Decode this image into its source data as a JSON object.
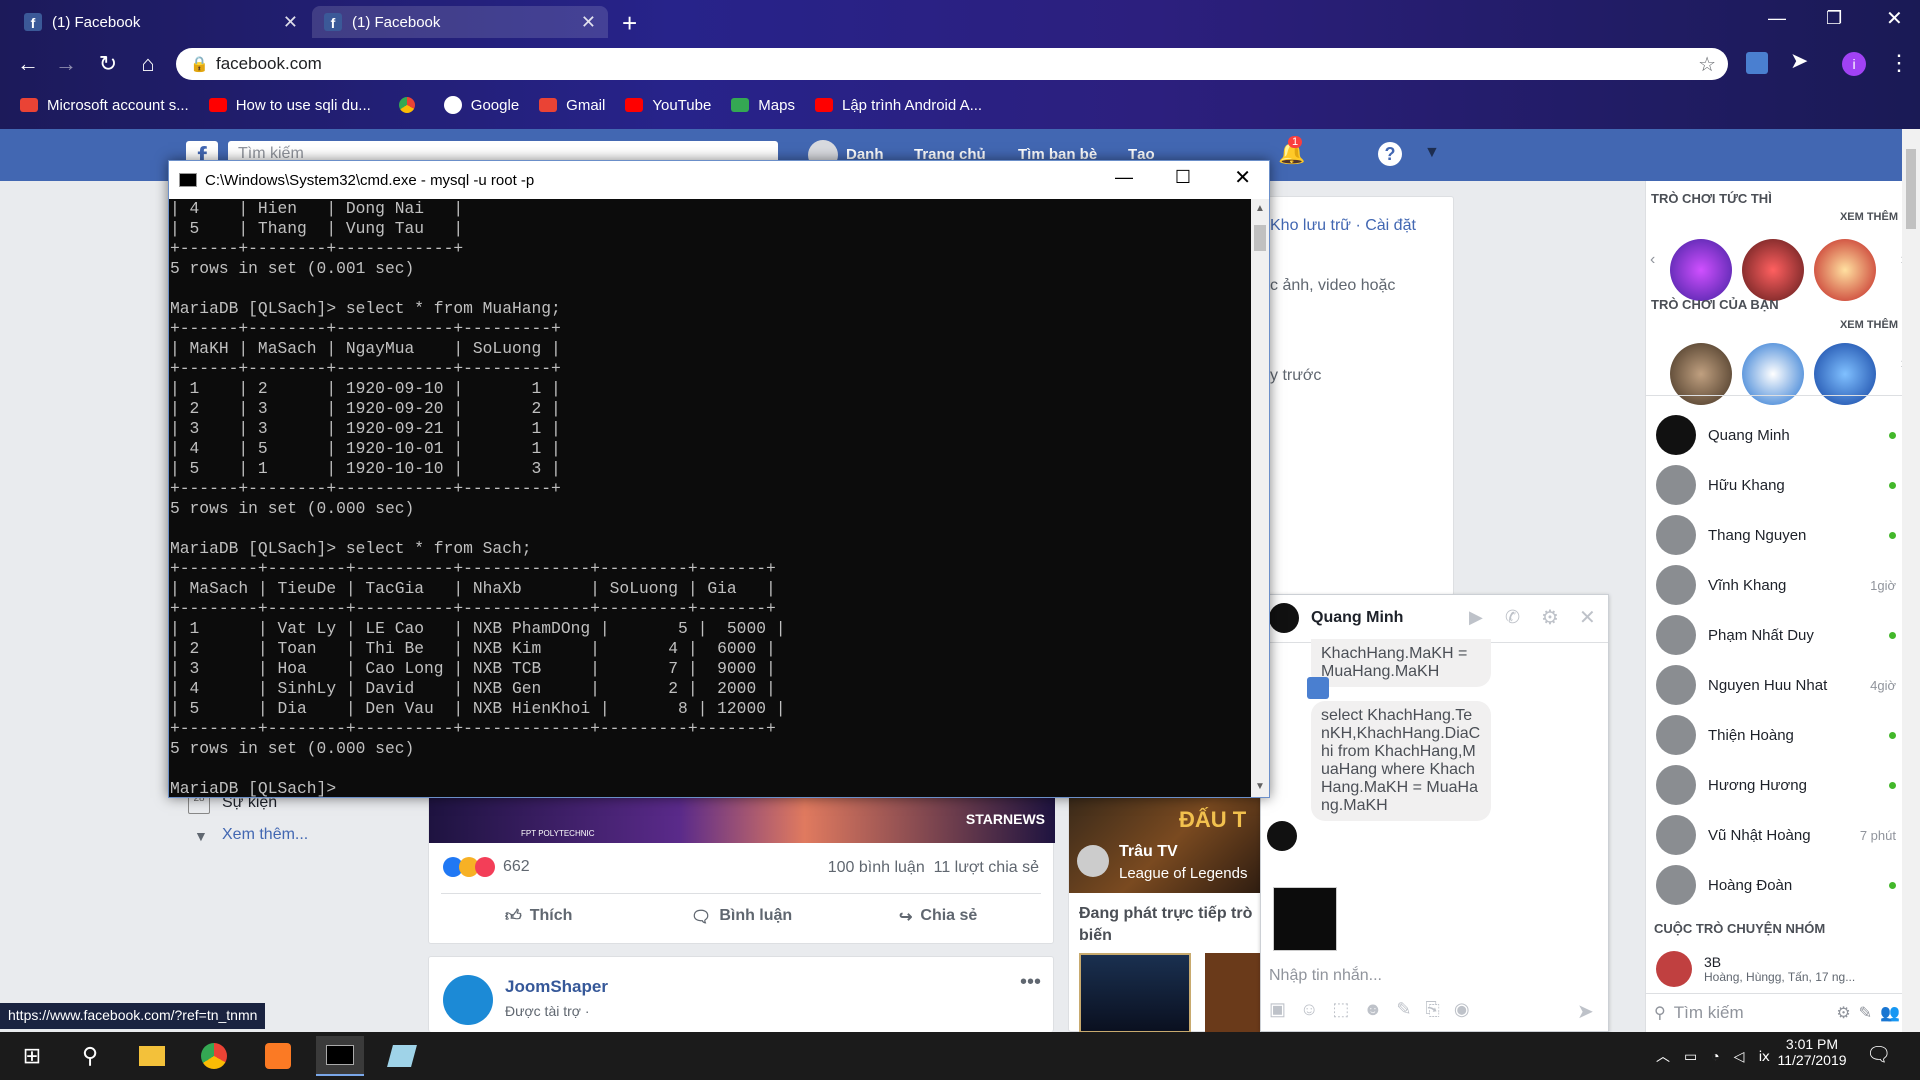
{
  "browser": {
    "tabs": [
      {
        "title": "(1) Facebook"
      },
      {
        "title": "(1) Facebook"
      }
    ],
    "url": "facebook.com",
    "bookmarks": [
      "Microsoft account s...",
      "How to use sqli du...",
      "Google",
      "Gmail",
      "YouTube",
      "Maps",
      "Lập trình Android A..."
    ],
    "profile_initial": "i",
    "status_url": "https://www.facebook.com/?ref=tn_tnmn"
  },
  "facebook": {
    "search_placeholder": "Tìm kiếm",
    "nav": [
      "Danh",
      "Trang chủ",
      "Tìm bạn bè",
      "Tạo"
    ],
    "notification_count": "1",
    "left_menu": [
      "Sự kiện",
      "Xem thêm..."
    ],
    "right_bits": [
      "Kho lưu trữ · Cài đặt",
      "c ảnh, video hoặc",
      "y trước"
    ],
    "post": {
      "reactions_count": "662",
      "comments_shares": "100 bình luận  11 lượt chia sẻ",
      "actions": [
        "Thích",
        "Bình luận",
        "Chia sẻ"
      ],
      "banner_brand": "STARNEWS",
      "banner_sub": "FPT POLYTECHNIC"
    },
    "sponsored": {
      "name": "JoomShaper",
      "label": "Được tài trợ ·"
    },
    "live": {
      "channel": "Trâu TV",
      "game": "League of Legends",
      "caption": "Đang phát trực tiếp trò biến",
      "banner": "ĐẤU T"
    },
    "games": {
      "instant_title": "TRÒ CHƠI TỨC THÌ",
      "yours_title": "TRÒ CHƠI CỦA BẠN",
      "see_more": "XEM THÊM"
    },
    "contacts": [
      {
        "name": "Quang Minh",
        "status": "online"
      },
      {
        "name": "Hữu Khang",
        "status": "online"
      },
      {
        "name": "Thang Nguyen",
        "status": "online"
      },
      {
        "name": "Vĩnh Khang",
        "status": "1giờ"
      },
      {
        "name": "Phạm Nhất Duy",
        "status": "online"
      },
      {
        "name": "Nguyen Huu Nhat",
        "status": "4giờ"
      },
      {
        "name": "Thiện Hoàng",
        "status": "online"
      },
      {
        "name": "Hương Hương",
        "status": "online"
      },
      {
        "name": "Vũ Nhật Hoàng",
        "status": "7 phút"
      },
      {
        "name": "Hoàng Đoàn",
        "status": "online"
      }
    ],
    "group_title": "CUỘC TRÒ CHUYỆN NHÓM",
    "group": {
      "name": "3B",
      "members": "Hoàng, Hùngg, Tấn, 17 ng..."
    },
    "sidebar_search": "Tìm kiếm",
    "chat": {
      "name": "Quang Minh",
      "msg1": "KhachHang.MaKH = MuaHang.MaKH",
      "msg2": "select KhachHang.TenKH,KhachHang.DiaChi from KhachHang,MuaHang where KhachHang.MaKH = MuaHang.MaKH",
      "input_placeholder": "Nhập tin nhắn..."
    }
  },
  "cmd": {
    "title": "C:\\Windows\\System32\\cmd.exe - mysql  -u root -p",
    "lines": [
      "| 4    | Hien   | Dong Nai   |",
      "| 5    | Thang  | Vung Tau   |",
      "+------+--------+------------+",
      "5 rows in set (0.001 sec)",
      "",
      "MariaDB [QLSach]> select * from MuaHang;",
      "+------+--------+------------+---------+",
      "| MaKH | MaSach | NgayMua    | SoLuong |",
      "+------+--------+------------+---------+",
      "| 1    | 2      | 1920-09-10 |       1 |",
      "| 2    | 3      | 1920-09-20 |       2 |",
      "| 3    | 3      | 1920-09-21 |       1 |",
      "| 4    | 5      | 1920-10-01 |       1 |",
      "| 5    | 1      | 1920-10-10 |       3 |",
      "+------+--------+------------+---------+",
      "5 rows in set (0.000 sec)",
      "",
      "MariaDB [QLSach]> select * from Sach;",
      "+--------+--------+----------+-------------+---------+-------+",
      "| MaSach | TieuDe | TacGia   | NhaXb       | SoLuong | Gia   |",
      "+--------+--------+----------+-------------+---------+-------+",
      "| 1      | Vat Ly | LE Cao   | NXB PhamDOng |       5 |  5000 |",
      "| 2      | Toan   | Thi Be   | NXB Kim     |       4 |  6000 |",
      "| 3      | Hoa    | Cao Long | NXB TCB     |       7 |  9000 |",
      "| 4      | SinhLy | David    | NXB Gen     |       2 |  2000 |",
      "| 5      | Dia    | Den Vau  | NXB HienKhoi |       8 | 12000 |",
      "+--------+--------+----------+-------------+---------+-------+",
      "5 rows in set (0.000 sec)",
      "",
      "MariaDB [QLSach]>"
    ]
  },
  "taskbar": {
    "time": "3:01 PM",
    "date": "11/27/2019"
  },
  "colors": {
    "fb_blue": "#4267b2",
    "online": "#42b72a",
    "cmd_bg": "#0c0c0c",
    "cmd_text": "#c0c0c0"
  }
}
